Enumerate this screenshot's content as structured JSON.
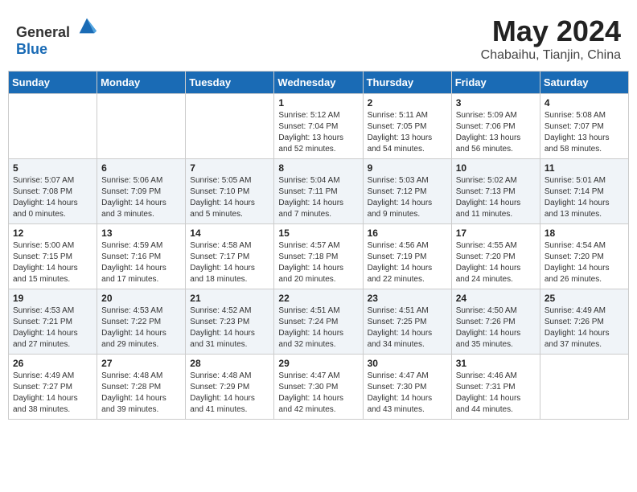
{
  "header": {
    "logo_general": "General",
    "logo_blue": "Blue",
    "month_year": "May 2024",
    "location": "Chabaihu, Tianjin, China"
  },
  "days_of_week": [
    "Sunday",
    "Monday",
    "Tuesday",
    "Wednesday",
    "Thursday",
    "Friday",
    "Saturday"
  ],
  "weeks": [
    [
      {
        "day": "",
        "sunrise": "",
        "sunset": "",
        "daylight": ""
      },
      {
        "day": "",
        "sunrise": "",
        "sunset": "",
        "daylight": ""
      },
      {
        "day": "",
        "sunrise": "",
        "sunset": "",
        "daylight": ""
      },
      {
        "day": "1",
        "sunrise": "Sunrise: 5:12 AM",
        "sunset": "Sunset: 7:04 PM",
        "daylight": "Daylight: 13 hours and 52 minutes."
      },
      {
        "day": "2",
        "sunrise": "Sunrise: 5:11 AM",
        "sunset": "Sunset: 7:05 PM",
        "daylight": "Daylight: 13 hours and 54 minutes."
      },
      {
        "day": "3",
        "sunrise": "Sunrise: 5:09 AM",
        "sunset": "Sunset: 7:06 PM",
        "daylight": "Daylight: 13 hours and 56 minutes."
      },
      {
        "day": "4",
        "sunrise": "Sunrise: 5:08 AM",
        "sunset": "Sunset: 7:07 PM",
        "daylight": "Daylight: 13 hours and 58 minutes."
      }
    ],
    [
      {
        "day": "5",
        "sunrise": "Sunrise: 5:07 AM",
        "sunset": "Sunset: 7:08 PM",
        "daylight": "Daylight: 14 hours and 0 minutes."
      },
      {
        "day": "6",
        "sunrise": "Sunrise: 5:06 AM",
        "sunset": "Sunset: 7:09 PM",
        "daylight": "Daylight: 14 hours and 3 minutes."
      },
      {
        "day": "7",
        "sunrise": "Sunrise: 5:05 AM",
        "sunset": "Sunset: 7:10 PM",
        "daylight": "Daylight: 14 hours and 5 minutes."
      },
      {
        "day": "8",
        "sunrise": "Sunrise: 5:04 AM",
        "sunset": "Sunset: 7:11 PM",
        "daylight": "Daylight: 14 hours and 7 minutes."
      },
      {
        "day": "9",
        "sunrise": "Sunrise: 5:03 AM",
        "sunset": "Sunset: 7:12 PM",
        "daylight": "Daylight: 14 hours and 9 minutes."
      },
      {
        "day": "10",
        "sunrise": "Sunrise: 5:02 AM",
        "sunset": "Sunset: 7:13 PM",
        "daylight": "Daylight: 14 hours and 11 minutes."
      },
      {
        "day": "11",
        "sunrise": "Sunrise: 5:01 AM",
        "sunset": "Sunset: 7:14 PM",
        "daylight": "Daylight: 14 hours and 13 minutes."
      }
    ],
    [
      {
        "day": "12",
        "sunrise": "Sunrise: 5:00 AM",
        "sunset": "Sunset: 7:15 PM",
        "daylight": "Daylight: 14 hours and 15 minutes."
      },
      {
        "day": "13",
        "sunrise": "Sunrise: 4:59 AM",
        "sunset": "Sunset: 7:16 PM",
        "daylight": "Daylight: 14 hours and 17 minutes."
      },
      {
        "day": "14",
        "sunrise": "Sunrise: 4:58 AM",
        "sunset": "Sunset: 7:17 PM",
        "daylight": "Daylight: 14 hours and 18 minutes."
      },
      {
        "day": "15",
        "sunrise": "Sunrise: 4:57 AM",
        "sunset": "Sunset: 7:18 PM",
        "daylight": "Daylight: 14 hours and 20 minutes."
      },
      {
        "day": "16",
        "sunrise": "Sunrise: 4:56 AM",
        "sunset": "Sunset: 7:19 PM",
        "daylight": "Daylight: 14 hours and 22 minutes."
      },
      {
        "day": "17",
        "sunrise": "Sunrise: 4:55 AM",
        "sunset": "Sunset: 7:20 PM",
        "daylight": "Daylight: 14 hours and 24 minutes."
      },
      {
        "day": "18",
        "sunrise": "Sunrise: 4:54 AM",
        "sunset": "Sunset: 7:20 PM",
        "daylight": "Daylight: 14 hours and 26 minutes."
      }
    ],
    [
      {
        "day": "19",
        "sunrise": "Sunrise: 4:53 AM",
        "sunset": "Sunset: 7:21 PM",
        "daylight": "Daylight: 14 hours and 27 minutes."
      },
      {
        "day": "20",
        "sunrise": "Sunrise: 4:53 AM",
        "sunset": "Sunset: 7:22 PM",
        "daylight": "Daylight: 14 hours and 29 minutes."
      },
      {
        "day": "21",
        "sunrise": "Sunrise: 4:52 AM",
        "sunset": "Sunset: 7:23 PM",
        "daylight": "Daylight: 14 hours and 31 minutes."
      },
      {
        "day": "22",
        "sunrise": "Sunrise: 4:51 AM",
        "sunset": "Sunset: 7:24 PM",
        "daylight": "Daylight: 14 hours and 32 minutes."
      },
      {
        "day": "23",
        "sunrise": "Sunrise: 4:51 AM",
        "sunset": "Sunset: 7:25 PM",
        "daylight": "Daylight: 14 hours and 34 minutes."
      },
      {
        "day": "24",
        "sunrise": "Sunrise: 4:50 AM",
        "sunset": "Sunset: 7:26 PM",
        "daylight": "Daylight: 14 hours and 35 minutes."
      },
      {
        "day": "25",
        "sunrise": "Sunrise: 4:49 AM",
        "sunset": "Sunset: 7:26 PM",
        "daylight": "Daylight: 14 hours and 37 minutes."
      }
    ],
    [
      {
        "day": "26",
        "sunrise": "Sunrise: 4:49 AM",
        "sunset": "Sunset: 7:27 PM",
        "daylight": "Daylight: 14 hours and 38 minutes."
      },
      {
        "day": "27",
        "sunrise": "Sunrise: 4:48 AM",
        "sunset": "Sunset: 7:28 PM",
        "daylight": "Daylight: 14 hours and 39 minutes."
      },
      {
        "day": "28",
        "sunrise": "Sunrise: 4:48 AM",
        "sunset": "Sunset: 7:29 PM",
        "daylight": "Daylight: 14 hours and 41 minutes."
      },
      {
        "day": "29",
        "sunrise": "Sunrise: 4:47 AM",
        "sunset": "Sunset: 7:30 PM",
        "daylight": "Daylight: 14 hours and 42 minutes."
      },
      {
        "day": "30",
        "sunrise": "Sunrise: 4:47 AM",
        "sunset": "Sunset: 7:30 PM",
        "daylight": "Daylight: 14 hours and 43 minutes."
      },
      {
        "day": "31",
        "sunrise": "Sunrise: 4:46 AM",
        "sunset": "Sunset: 7:31 PM",
        "daylight": "Daylight: 14 hours and 44 minutes."
      },
      {
        "day": "",
        "sunrise": "",
        "sunset": "",
        "daylight": ""
      }
    ]
  ]
}
